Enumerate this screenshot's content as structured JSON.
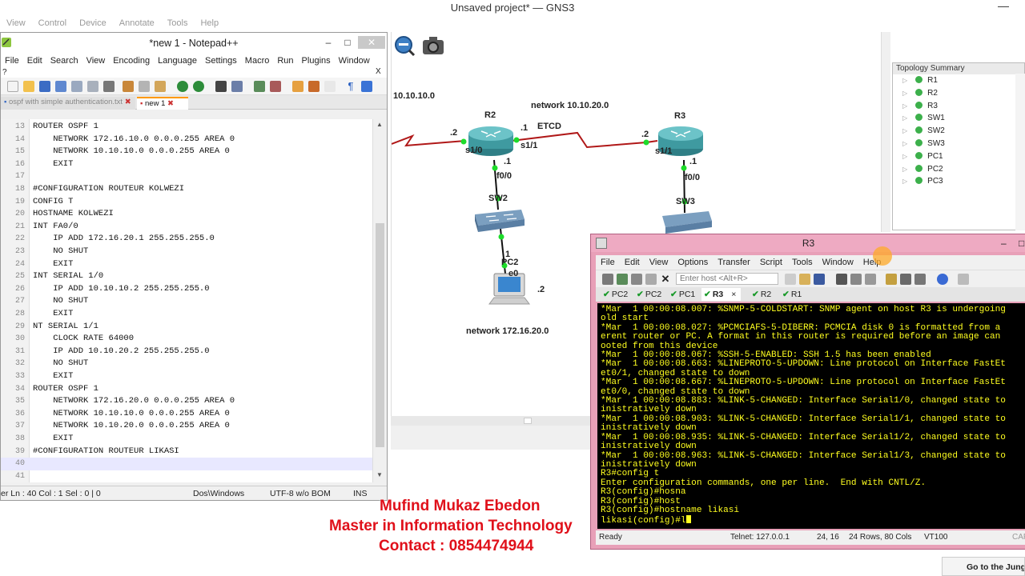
{
  "gns3": {
    "title": "Unsaved project* — GNS3",
    "menu": [
      "View",
      "Control",
      "Device",
      "Annotate",
      "Tools",
      "Help"
    ],
    "labels": {
      "net1": "10.10.10.0",
      "net2": "network 10.10.20.0",
      "net3": "network 172.16.20.0",
      "etcd": "ETCD",
      "r2": "R2",
      "r3": "R3",
      "sw2": "SW2",
      "sw3": "SW3",
      "pc2": "PC2",
      "e0": "e0",
      "r2_s10": "s1/0",
      "r2_s11": "s1/1",
      "r2_f00": "f0/0",
      "r3_s11": "s1/1",
      "r3_f00": "f0/0",
      "dot2a": ".2",
      "dot1a": ".1",
      "dot2b": ".2",
      "dot1b": ".1",
      "dot1c": ".1",
      "dot1d": "1",
      "dot2c": ".2"
    },
    "topology": {
      "header": "Topology Summary",
      "items": [
        "R1",
        "R2",
        "R3",
        "SW1",
        "SW2",
        "SW3",
        "PC1",
        "PC2",
        "PC3"
      ]
    }
  },
  "notepad": {
    "title": "*new  1 - Notepad++",
    "menu": [
      "File",
      "Edit",
      "Search",
      "View",
      "Encoding",
      "Language",
      "Settings",
      "Macro",
      "Run",
      "Plugins",
      "Window"
    ],
    "q": "?",
    "x": "X",
    "tabs": [
      "ospf with simple authentication.txt",
      "new  1"
    ],
    "lines": [
      {
        "n": "13",
        "t": "ROUTER OSPF 1"
      },
      {
        "n": "14",
        "t": "    NETWORK 172.16.10.0 0.0.0.255 AREA 0"
      },
      {
        "n": "15",
        "t": "    NETWORK 10.10.10.0 0.0.0.255 AREA 0"
      },
      {
        "n": "16",
        "t": "    EXIT"
      },
      {
        "n": "17",
        "t": ""
      },
      {
        "n": "18",
        "t": "#CONFIGURATION ROUTEUR KOLWEZI"
      },
      {
        "n": "19",
        "t": "CONFIG T"
      },
      {
        "n": "20",
        "t": "HOSTNAME KOLWEZI"
      },
      {
        "n": "21",
        "t": "INT FA0/0"
      },
      {
        "n": "22",
        "t": "    IP ADD 172.16.20.1 255.255.255.0"
      },
      {
        "n": "23",
        "t": "    NO SHUT"
      },
      {
        "n": "24",
        "t": "    EXIT"
      },
      {
        "n": "25",
        "t": "INT SERIAL 1/0"
      },
      {
        "n": "26",
        "t": "    IP ADD 10.10.10.2 255.255.255.0"
      },
      {
        "n": "27",
        "t": "    NO SHUT"
      },
      {
        "n": "28",
        "t": "    EXIT"
      },
      {
        "n": "29",
        "t": "NT SERIAL 1/1"
      },
      {
        "n": "30",
        "t": "    CLOCK RATE 64000"
      },
      {
        "n": "31",
        "t": "    IP ADD 10.10.20.2 255.255.255.0"
      },
      {
        "n": "32",
        "t": "    NO SHUT"
      },
      {
        "n": "33",
        "t": "    EXIT"
      },
      {
        "n": "34",
        "t": "ROUTER OSPF 1"
      },
      {
        "n": "35",
        "t": "    NETWORK 172.16.20.0 0.0.0.255 AREA 0"
      },
      {
        "n": "36",
        "t": "    NETWORK 10.10.10.0 0.0.0.255 AREA 0"
      },
      {
        "n": "37",
        "t": "    NETWORK 10.10.20.0 0.0.0.255 AREA 0"
      },
      {
        "n": "38",
        "t": "    EXIT"
      },
      {
        "n": "39",
        "t": "#CONFIGURATION ROUTEUR LIKASI"
      },
      {
        "n": "40",
        "t": ""
      },
      {
        "n": "41",
        "t": ""
      }
    ],
    "status": {
      "pos": "er Ln : 40    Col : 1    Sel : 0 | 0",
      "eol": "Dos\\Windows",
      "enc": "UTF-8 w/o BOM",
      "mode": "INS"
    }
  },
  "crt": {
    "title": "R3",
    "menu": [
      "File",
      "Edit",
      "View",
      "Options",
      "Transfer",
      "Script",
      "Tools",
      "Window",
      "Help"
    ],
    "host_placeholder": "Enter host <Alt+R>",
    "tabs": [
      "PC2",
      "PC2",
      "PC1",
      "R3",
      "R2",
      "R1"
    ],
    "tab_close": "×",
    "terminal": [
      "*Mar  1 00:00:08.007: %SNMP-5-COLDSTART: SNMP agent on host R3 is undergoing",
      "old start",
      "*Mar  1 00:00:08.027: %PCMCIAFS-5-DIBERR: PCMCIA disk 0 is formatted from a",
      "erent router or PC. A format in this router is required before an image can",
      "ooted from this device",
      "*Mar  1 00:00:08.067: %SSH-5-ENABLED: SSH 1.5 has been enabled",
      "*Mar  1 00:00:08.663: %LINEPROTO-5-UPDOWN: Line protocol on Interface FastEt",
      "et0/1, changed state to down",
      "*Mar  1 00:00:08.667: %LINEPROTO-5-UPDOWN: Line protocol on Interface FastEt",
      "et0/0, changed state to down",
      "*Mar  1 00:00:08.883: %LINK-5-CHANGED: Interface Serial1/0, changed state to",
      "inistratively down",
      "*Mar  1 00:00:08.903: %LINK-5-CHANGED: Interface Serial1/1, changed state to",
      "inistratively down",
      "*Mar  1 00:00:08.935: %LINK-5-CHANGED: Interface Serial1/2, changed state to",
      "inistratively down",
      "*Mar  1 00:00:08.963: %LINK-5-CHANGED: Interface Serial1/3, changed state to",
      "inistratively down",
      "R3#config t",
      "Enter configuration commands, one per line.  End with CNTL/Z.",
      "R3(config)#hosna",
      "R3(config)#host",
      "R3(config)#hostname likasi"
    ],
    "prompt": "likasi(config)#l",
    "status": {
      "ready": "Ready",
      "telnet": "Telnet: 127.0.0.1",
      "pos": "24, 16",
      "size": "24 Rows, 80 Cols",
      "term": "VT100",
      "cap": "CAP"
    }
  },
  "credits": {
    "name": "Mufind Mukaz Ebedon",
    "degree": "Master in Information Technology",
    "contact": "Contact : 0854474944"
  },
  "popup": {
    "text": "Go to the Jung"
  }
}
